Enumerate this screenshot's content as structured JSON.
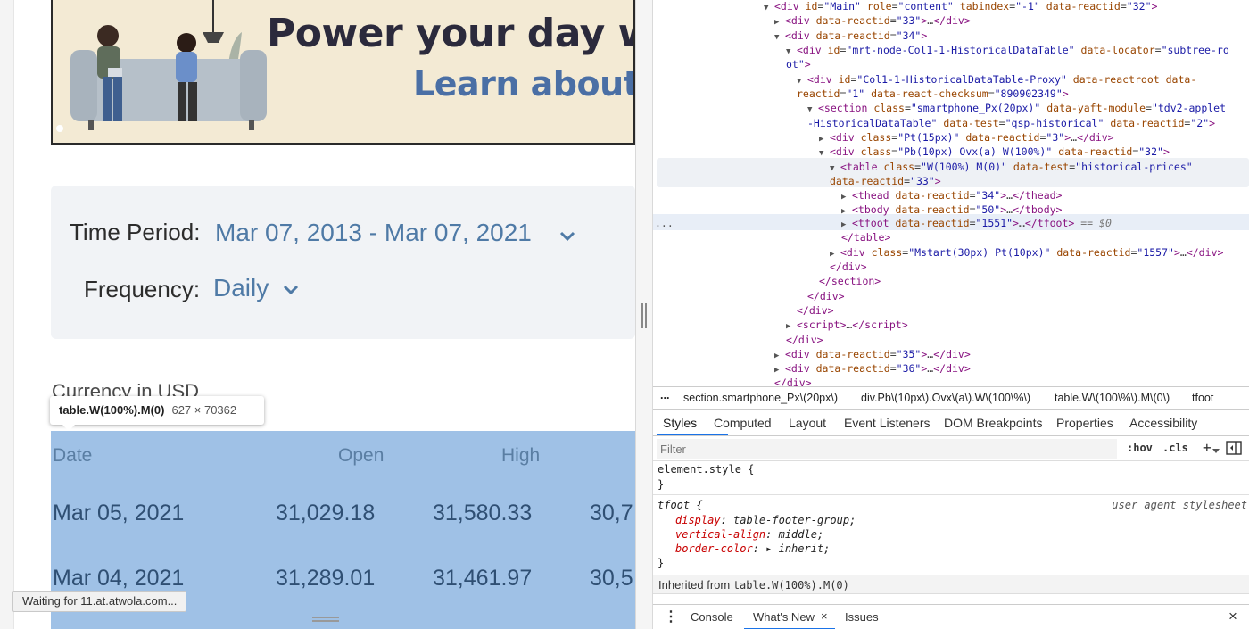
{
  "banner": {
    "headline": "Power your day wi",
    "subline": "Learn about T"
  },
  "filters": {
    "time_period_label": "Time Period:",
    "time_period_value": "Mar 07, 2013 - Mar 07, 2021",
    "frequency_label": "Frequency:",
    "frequency_value": "Daily"
  },
  "currency_note": "Currency in USD",
  "inspect_tooltip": {
    "selector": "table.W(100%).M(0)",
    "size": "627 × 70362"
  },
  "table": {
    "headers": [
      "Date",
      "Open",
      "High"
    ],
    "rows": [
      {
        "date": "Mar 05, 2021",
        "open": "31,029.18",
        "high": "31,580.33",
        "low": "30,7"
      },
      {
        "date": "Mar 04, 2021",
        "open": "31,289.01",
        "high": "31,461.97",
        "low": "30,5"
      }
    ]
  },
  "status_text": "Waiting for 11.at.atwola.com...",
  "dom_tree": {
    "ellipsis": "...",
    "dollar_zero": "== $0"
  },
  "breadcrumbs": {
    "more": "...",
    "items": [
      "section.smartphone_Px\\(20px\\)",
      "div.Pb\\(10px\\).Ovx\\(a\\).W\\(100\\%\\)",
      "table.W\\(100\\%\\).M\\(0\\)",
      "tfoot"
    ]
  },
  "devtools_tabs": [
    "Styles",
    "Computed",
    "Layout",
    "Event Listeners",
    "DOM Breakpoints",
    "Properties",
    "Accessibility"
  ],
  "styles_filter": {
    "placeholder": "Filter",
    "hov": ":hov",
    "cls": ".cls",
    "plus": "+"
  },
  "styles_pane": {
    "element_style": "element.style {",
    "close_brace": "}",
    "tfoot_selector": "tfoot {",
    "tfoot_source": "user agent stylesheet",
    "props": [
      {
        "name": "display",
        "value": "table-footer-group;"
      },
      {
        "name": "vertical-align",
        "value": "middle;"
      },
      {
        "name": "border-color",
        "value": "▸ inherit;"
      }
    ],
    "inherited_label": "Inherited from",
    "inherited_selector": "table.W(100%).M(0)"
  },
  "drawer_tabs": [
    "Console",
    "What's New",
    "Issues"
  ],
  "drawer_close_tab": "×",
  "drawer_close": "×",
  "drawer_menu": "⋮",
  "colors": {
    "accent": "#1a73e8",
    "link_blue": "#4f7aa6",
    "table_highlight": "#9fc1e6",
    "tag_purple": "#881280",
    "attr_brown": "#994500",
    "attr_value_blue": "#1a1aa6"
  }
}
